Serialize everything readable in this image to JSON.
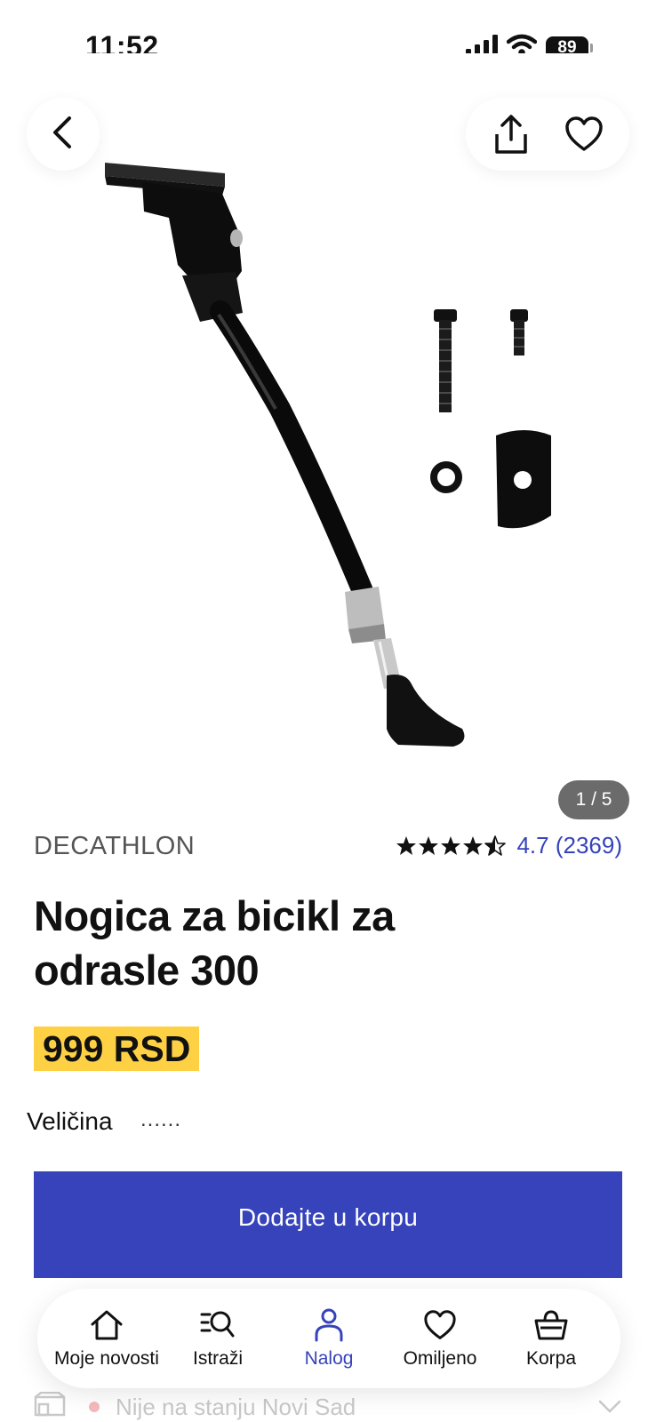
{
  "status_bar": {
    "time": "11:52",
    "battery": "89",
    "icons": [
      "signal-icon",
      "wifi-icon",
      "battery-icon"
    ]
  },
  "gallery": {
    "image_description_icon": "product-image",
    "counter": "1 / 5",
    "buttons": [
      "back-icon",
      "share-icon",
      "heart-icon"
    ]
  },
  "product": {
    "brand": "DECATHLON",
    "rating": 4.7,
    "rating_text": "4.7 (2369)",
    "title_line1": "Nogica za bicikl za",
    "title_line2": "odrasle 300",
    "price": "999 RSD",
    "size_label": "Veličina",
    "size_value": "......"
  },
  "cta": {
    "add_to_cart": "Dodajte u korpu"
  },
  "availability": {
    "text": "Nije na stanju Novi Sad"
  },
  "bottom_nav": {
    "items": [
      {
        "label": "Moje novosti",
        "icon": "home-icon"
      },
      {
        "label": "Istraži",
        "icon": "search-list-icon"
      },
      {
        "label": "Nalog",
        "icon": "user-icon",
        "active": true
      },
      {
        "label": "Omiljeno",
        "icon": "heart-icon"
      },
      {
        "label": "Korpa",
        "icon": "basket-icon"
      }
    ]
  },
  "colors": {
    "accent": "#3643ba",
    "price_highlight": "#fed145",
    "counter_bg": "#6b6b6b"
  }
}
